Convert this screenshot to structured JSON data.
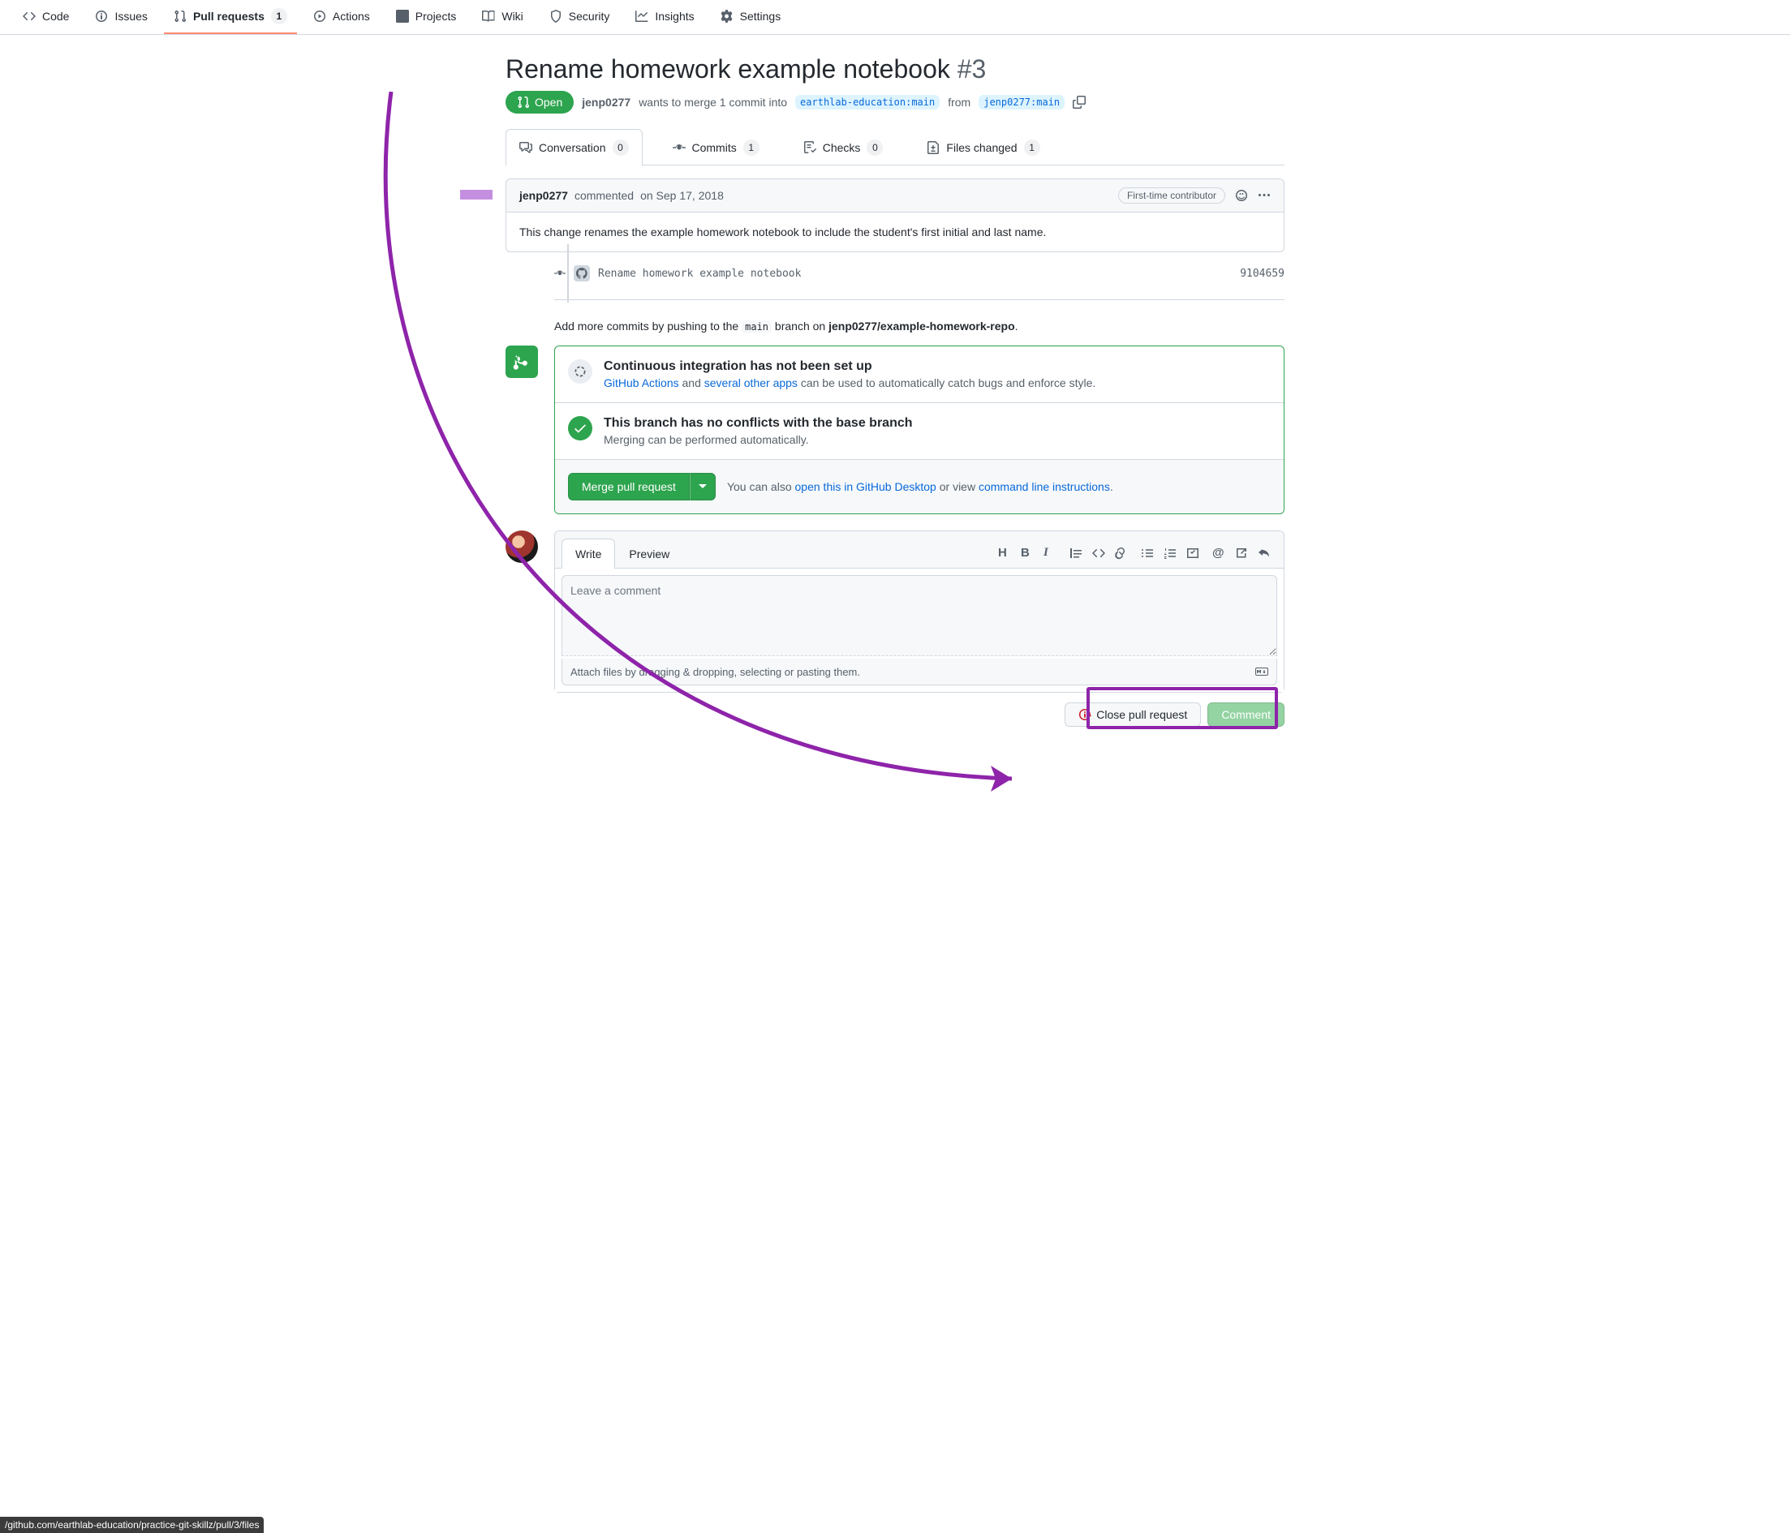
{
  "repoNav": {
    "items": [
      {
        "label": "Code"
      },
      {
        "label": "Issues"
      },
      {
        "label": "Pull requests",
        "count": "1"
      },
      {
        "label": "Actions"
      },
      {
        "label": "Projects"
      },
      {
        "label": "Wiki"
      },
      {
        "label": "Security"
      },
      {
        "label": "Insights"
      },
      {
        "label": "Settings"
      }
    ]
  },
  "pr": {
    "title": "Rename homework example notebook",
    "number": "#3",
    "state": "Open",
    "author": "jenp0277",
    "wants": "wants to merge 1 commit into",
    "base": "earthlab-education:main",
    "from_word": "from",
    "head": "jenp0277:main"
  },
  "prTabs": {
    "items": [
      {
        "label": "Conversation",
        "count": "0"
      },
      {
        "label": "Commits",
        "count": "1"
      },
      {
        "label": "Checks",
        "count": "0"
      },
      {
        "label": "Files changed",
        "count": "1"
      }
    ]
  },
  "comment": {
    "author": "jenp0277",
    "verb": "commented",
    "when": "on Sep 17, 2018",
    "badge": "First-time contributor",
    "body": "This change renames the example homework notebook to include the student's first initial and last name."
  },
  "commit": {
    "msg": "Rename homework example notebook",
    "sha": "9104659"
  },
  "pushHint": {
    "prefix": "Add more commits by pushing to the",
    "branch": "main",
    "middle": "branch on",
    "repo": "jenp0277/example-homework-repo",
    "suffix": "."
  },
  "mergeBox": {
    "ci_title": "Continuous integration has not been set up",
    "ci_link1": "GitHub Actions",
    "ci_and": "and",
    "ci_link2": "several other apps",
    "ci_rest": "can be used to automatically catch bugs and enforce style.",
    "ok_title": "This branch has no conflicts with the base branch",
    "ok_sub": "Merging can be performed automatically.",
    "btn": "Merge pull request",
    "aside_pre": "You can also",
    "aside_link1": "open this in GitHub Desktop",
    "aside_mid": "or view",
    "aside_link2": "command line instructions",
    "aside_post": "."
  },
  "compose": {
    "tab_write": "Write",
    "tab_preview": "Preview",
    "placeholder": "Leave a comment",
    "attach": "Attach files by dragging & dropping, selecting or pasting them.",
    "close_btn": "Close pull request",
    "comment_btn": "Comment"
  },
  "statusUrl": "/github.com/earthlab-education/practice-git-skillz/pull/3/files"
}
